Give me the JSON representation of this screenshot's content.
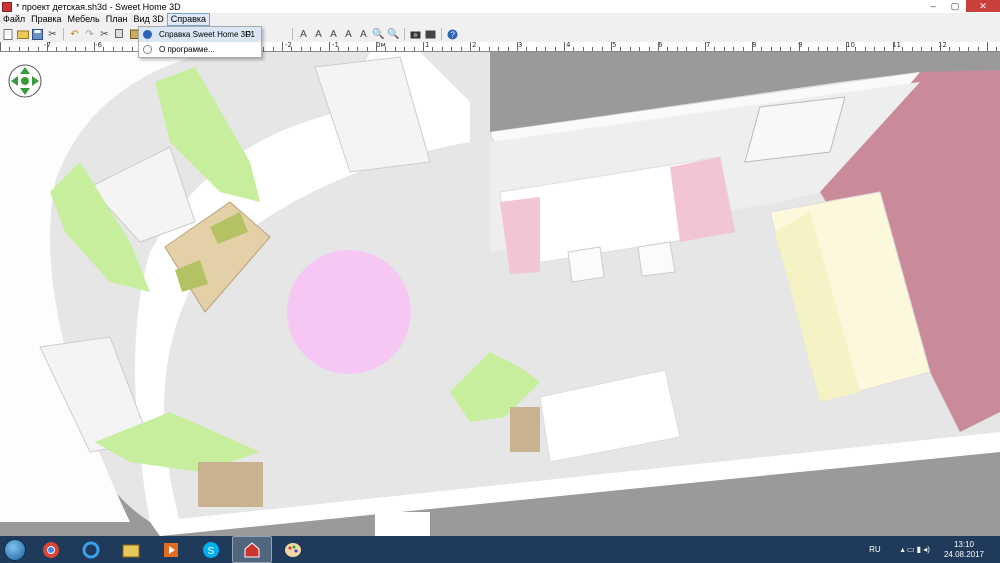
{
  "window": {
    "title": "* проект детская.sh3d - Sweet Home 3D",
    "min_label": "–",
    "max_label": "▢",
    "close_label": "✕"
  },
  "menu": {
    "items": [
      "Файл",
      "Правка",
      "Мебель",
      "План",
      "Вид 3D",
      "Справка"
    ],
    "active": "Справка"
  },
  "dropdown": {
    "items": [
      {
        "label": "Справка Sweet Home 3D",
        "shortcut": "F1",
        "icon": "help-icon"
      },
      {
        "label": "О программе...",
        "shortcut": "",
        "icon": "info-icon"
      }
    ]
  },
  "toolbar": {
    "icons": [
      "new-icon",
      "open-icon",
      "save-icon",
      "cut-icon",
      "undo-icon",
      "redo-icon",
      "cut-icon",
      "copy-icon",
      "paste-icon",
      "help-icon",
      "select-icon",
      "pan-icon",
      "create-walls-icon",
      "create-rooms-icon",
      "create-dimensions-icon",
      "create-labels-icon",
      "text-style-icon",
      "zoom-in-icon",
      "zoom-out-icon",
      "create-photo-icon",
      "create-video-icon",
      "help-icon"
    ]
  },
  "ruler": {
    "labels": [
      "-7",
      "-6",
      "-5",
      "-4",
      "-3",
      "-2",
      "-1",
      "0м",
      "1",
      "2",
      "3",
      "4",
      "5",
      "6",
      "7",
      "8",
      "9",
      "10",
      "11",
      "12"
    ]
  },
  "colors": {
    "floor": "#e6e6e6",
    "wall": "#ffffff",
    "pink_wall": "#c98b9a",
    "curtain": "#c6ee9c",
    "rug": "#f7c7f3",
    "taskbar": "#1f3a5a"
  },
  "taskbar": {
    "apps": [
      "windows-explorer-icon",
      "chrome-icon",
      "internet-explorer-icon",
      "file-explorer-icon",
      "media-player-icon",
      "skype-icon",
      "sweet-home-3d-icon",
      "paint-icon"
    ],
    "active_app": "sweet-home-3d-icon",
    "lang": "RU",
    "time": "13:10",
    "date": "24.08.2017"
  }
}
